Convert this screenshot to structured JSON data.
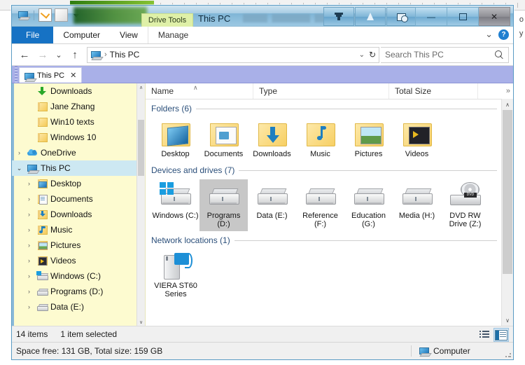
{
  "background": {
    "right_text_line1": "o",
    "right_text_line2": "y"
  },
  "window": {
    "title": "This PC",
    "contextual_tab": "Drive Tools",
    "quick_access": [
      {
        "name": "this-pc-icon",
        "label": "This PC"
      },
      {
        "name": "properties-icon",
        "label": "Properties"
      },
      {
        "name": "new-folder-icon",
        "label": "New folder"
      },
      {
        "name": "customize-qat-icon",
        "label": "Customize Quick Access Toolbar"
      }
    ],
    "extra_toolbar_buttons": [
      {
        "name": "filter-icon",
        "label": "Filter"
      },
      {
        "name": "cursor-icon",
        "label": "Select"
      },
      {
        "name": "folder-history-icon",
        "label": "Recent folders"
      },
      {
        "name": "pin-icon",
        "label": "Pin"
      }
    ],
    "controls": {
      "minimize": "—",
      "maximize": "■",
      "close": "✕"
    }
  },
  "ribbon": {
    "tabs": [
      {
        "label": "File",
        "active": false,
        "style": "file"
      },
      {
        "label": "Computer",
        "active": false,
        "style": "normal"
      },
      {
        "label": "View",
        "active": false,
        "style": "normal"
      },
      {
        "label": "Manage",
        "active": false,
        "style": "contextual"
      }
    ],
    "collapse_caret": "⌄",
    "help_label": "?"
  },
  "address": {
    "back": "←",
    "forward": "→",
    "recent": "⌄",
    "up": "↑",
    "breadcrumb_icon": "this-pc-icon",
    "separator": "›",
    "path": "This PC",
    "dropdown": "⌄",
    "refresh": "↻"
  },
  "search": {
    "placeholder": "Search This PC",
    "icon": "search-icon"
  },
  "tabstrip": {
    "tabs": [
      {
        "label": "This PC",
        "icon": "this-pc-icon",
        "close": "✕",
        "active": true
      }
    ]
  },
  "navpane": {
    "items": [
      {
        "label": "Downloads",
        "icon": "download-arrow-icon",
        "indent": 2,
        "chevron": "",
        "selected": false
      },
      {
        "label": "Jane Zhang",
        "icon": "folder-icon",
        "indent": 2,
        "chevron": "",
        "selected": false
      },
      {
        "label": "Win10 texts",
        "icon": "folder-icon",
        "indent": 2,
        "chevron": "",
        "selected": false
      },
      {
        "label": "Windows 10",
        "icon": "folder-icon",
        "indent": 2,
        "chevron": "",
        "selected": false
      },
      {
        "label": "OneDrive",
        "icon": "cloud-icon",
        "indent": 1,
        "chevron": "›",
        "selected": false
      },
      {
        "label": "This PC",
        "icon": "this-pc-icon",
        "indent": 1,
        "chevron": "⌄",
        "selected": true
      },
      {
        "label": "Desktop",
        "icon": "desktop-icon",
        "indent": 2,
        "chevron": "›",
        "selected": false
      },
      {
        "label": "Documents",
        "icon": "documents-icon",
        "indent": 2,
        "chevron": "›",
        "selected": false
      },
      {
        "label": "Downloads",
        "icon": "downloads-folder-icon",
        "indent": 2,
        "chevron": "›",
        "selected": false
      },
      {
        "label": "Music",
        "icon": "music-icon",
        "indent": 2,
        "chevron": "›",
        "selected": false
      },
      {
        "label": "Pictures",
        "icon": "pictures-icon",
        "indent": 2,
        "chevron": "›",
        "selected": false
      },
      {
        "label": "Videos",
        "icon": "videos-icon",
        "indent": 2,
        "chevron": "›",
        "selected": false
      },
      {
        "label": "Windows (C:)",
        "icon": "windows-drive-icon",
        "indent": 2,
        "chevron": "›",
        "selected": false
      },
      {
        "label": "Programs (D:)",
        "icon": "drive-icon",
        "indent": 2,
        "chevron": "›",
        "selected": false
      },
      {
        "label": "Data (E:)",
        "icon": "drive-icon",
        "indent": 2,
        "chevron": "›",
        "selected": false
      }
    ],
    "scroll_up": "∧",
    "scroll_down": "∨"
  },
  "columns": {
    "name": "Name",
    "type": "Type",
    "total_size": "Total Size",
    "more": "»",
    "sort_caret": "∧"
  },
  "groups": [
    {
      "title": "Folders (6)",
      "collapse": "∧",
      "items": [
        {
          "label": "Desktop",
          "icon": "folder-desktop-icon",
          "selected": false
        },
        {
          "label": "Documents",
          "icon": "folder-documents-icon",
          "selected": false
        },
        {
          "label": "Downloads",
          "icon": "folder-downloads-icon",
          "selected": false
        },
        {
          "label": "Music",
          "icon": "folder-music-icon",
          "selected": false
        },
        {
          "label": "Pictures",
          "icon": "folder-pictures-icon",
          "selected": false
        },
        {
          "label": "Videos",
          "icon": "folder-videos-icon",
          "selected": false
        }
      ]
    },
    {
      "title": "Devices and drives (7)",
      "collapse": "∧",
      "items": [
        {
          "label": "Windows (C:)",
          "icon": "windows-drive-icon",
          "selected": false
        },
        {
          "label": "Programs (D:)",
          "icon": "drive-icon",
          "selected": true
        },
        {
          "label": "Data (E:)",
          "icon": "drive-icon",
          "selected": false
        },
        {
          "label": "Reference (F:)",
          "icon": "drive-icon",
          "selected": false
        },
        {
          "label": "Education (G:)",
          "icon": "drive-icon",
          "selected": false
        },
        {
          "label": "Media (H:)",
          "icon": "drive-icon",
          "selected": false
        },
        {
          "label": "DVD RW Drive (Z:)",
          "icon": "dvd-drive-icon",
          "selected": false
        }
      ]
    },
    {
      "title": "Network locations (1)",
      "collapse": "∧",
      "items": [
        {
          "label": "VIERA ST60 Series",
          "icon": "network-media-device-icon",
          "selected": false
        }
      ]
    }
  ],
  "statusbar": {
    "item_count": "14 items",
    "selection": "1 item selected",
    "details": "Space free: 131 GB, Total size: 159 GB",
    "computer_label": "Computer",
    "view_buttons": [
      {
        "name": "details-view-button",
        "active": false
      },
      {
        "name": "large-icons-view-button",
        "active": true
      }
    ]
  },
  "colors": {
    "accent_blue": "#1672c4",
    "titlebar_blue": "#7fb5d6",
    "navpane_cream": "#fdfbd0",
    "tabstrip_periwinkle": "#a9b0e8",
    "selection_gray": "#c7c7c7",
    "nav_selected": "#cde8f2",
    "contextual_green": "#dff0a8",
    "group_header_text": "#2b4f7a"
  }
}
